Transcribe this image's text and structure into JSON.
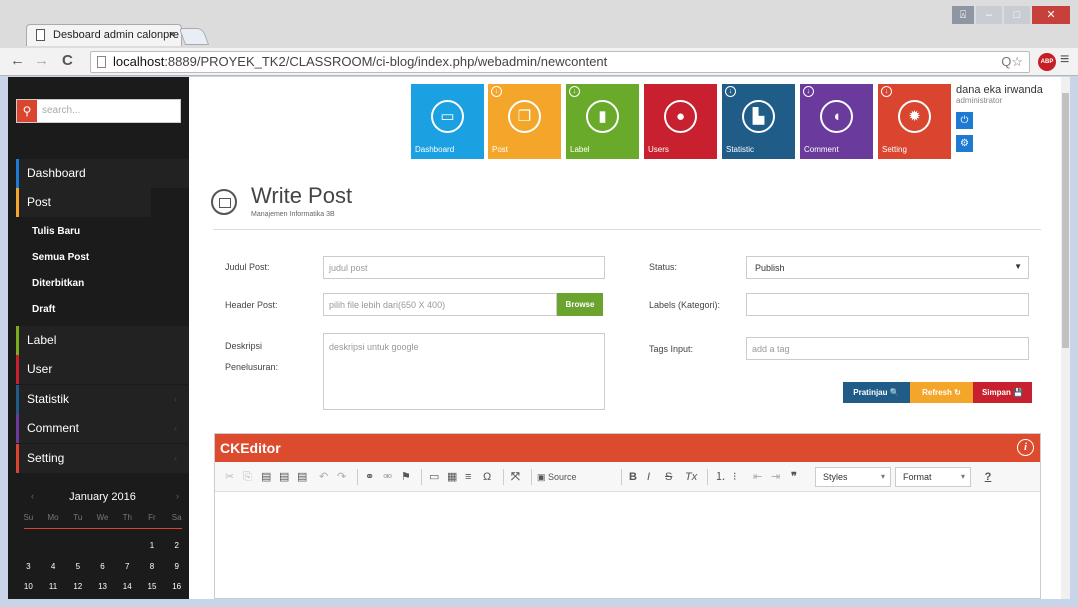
{
  "browser": {
    "tab_title": "Desboard admin calonpre",
    "tab_close": "×",
    "url_host": "localhost",
    "url_rest": ":8889/PROYEK_TK2/CLASSROOM/ci-blog/index.php/webadmin/newcontent",
    "abp": "ABP",
    "back": "←",
    "forward": "→",
    "reload": "C",
    "zoom_star": "Q☆",
    "menu": "≡",
    "win_user": "⍓",
    "win_min": "–",
    "win_max": "□",
    "win_close": "✕"
  },
  "sidebar": {
    "search_placeholder": "search...",
    "items": [
      {
        "label": "Dashboard"
      },
      {
        "label": "Post"
      },
      {
        "label": "Label"
      },
      {
        "label": "User"
      },
      {
        "label": "Statistik"
      },
      {
        "label": "Comment"
      },
      {
        "label": "Setting"
      }
    ],
    "post_sub": [
      {
        "label": "Tulis Baru"
      },
      {
        "label": "Semua Post"
      },
      {
        "label": "Diterbitkan"
      },
      {
        "label": "Draft"
      }
    ],
    "accent_colors": [
      "#1f7ad2",
      "#f4a62a",
      "#7bae1e",
      "#c8202f",
      "#1f5c87",
      "#6a3a9c",
      "#d9452e"
    ]
  },
  "calendar": {
    "month": "January 2016",
    "prev": "‹",
    "next": "›",
    "dows": [
      "Su",
      "Mo",
      "Tu",
      "We",
      "Th",
      "Fr",
      "Sa"
    ],
    "rows": [
      [
        "",
        "",
        "",
        "",
        "",
        "1",
        "2"
      ],
      [
        "3",
        "4",
        "5",
        "6",
        "7",
        "8",
        "9"
      ],
      [
        "10",
        "11",
        "12",
        "13",
        "14",
        "15",
        "16"
      ]
    ]
  },
  "tiles": [
    {
      "label": "Dashboard",
      "color": "#1ba1e2",
      "icon": "monitor-icon",
      "glyph": "▭",
      "arrow": false
    },
    {
      "label": "Post",
      "color": "#f4a62a",
      "icon": "copy-icon",
      "glyph": "❐",
      "arrow": true
    },
    {
      "label": "Label",
      "color": "#6aaa2a",
      "icon": "bookmark-icon",
      "glyph": "▮",
      "arrow": true
    },
    {
      "label": "Users",
      "color": "#c8202f",
      "icon": "user-icon",
      "glyph": "●",
      "arrow": false
    },
    {
      "label": "Statistic",
      "color": "#1f5c87",
      "icon": "chart-icon",
      "glyph": "▙",
      "arrow": true
    },
    {
      "label": "Comment",
      "color": "#6a3a9c",
      "icon": "comment-icon",
      "glyph": "◖",
      "arrow": true
    },
    {
      "label": "Setting",
      "color": "#d9452e",
      "icon": "gear-icon",
      "glyph": "✹",
      "arrow": true
    }
  ],
  "user": {
    "name": "dana eka irwanda",
    "role": "administrator",
    "power": "⏻",
    "gears": "⚙"
  },
  "page": {
    "title": "Write Post",
    "subtitle": "Manajemen Informatika 3B"
  },
  "form": {
    "judul_label": "Judul Post:",
    "judul_placeholder": "judul post",
    "header_label": "Header Post:",
    "header_placeholder": "pilih file lebih dari(650 X 400)",
    "browse": "Browse",
    "desc_label1": "Deskripsi",
    "desc_label2": "Penelusuran:",
    "desc_placeholder": "deskripsi untuk google",
    "status_label": "Status:",
    "status_value": "Publish",
    "labels_label": "Labels (Kategori):",
    "tags_label": "Tags Input:",
    "tags_placeholder": "add a tag",
    "pratinjau": "Pratinjau 🔍",
    "refresh": "Refresh ↻",
    "simpan": "Simpan 💾"
  },
  "editor": {
    "title": "CKEditor",
    "info": "i",
    "source": "Source",
    "styles": "Styles",
    "format": "Format",
    "help": "?"
  }
}
